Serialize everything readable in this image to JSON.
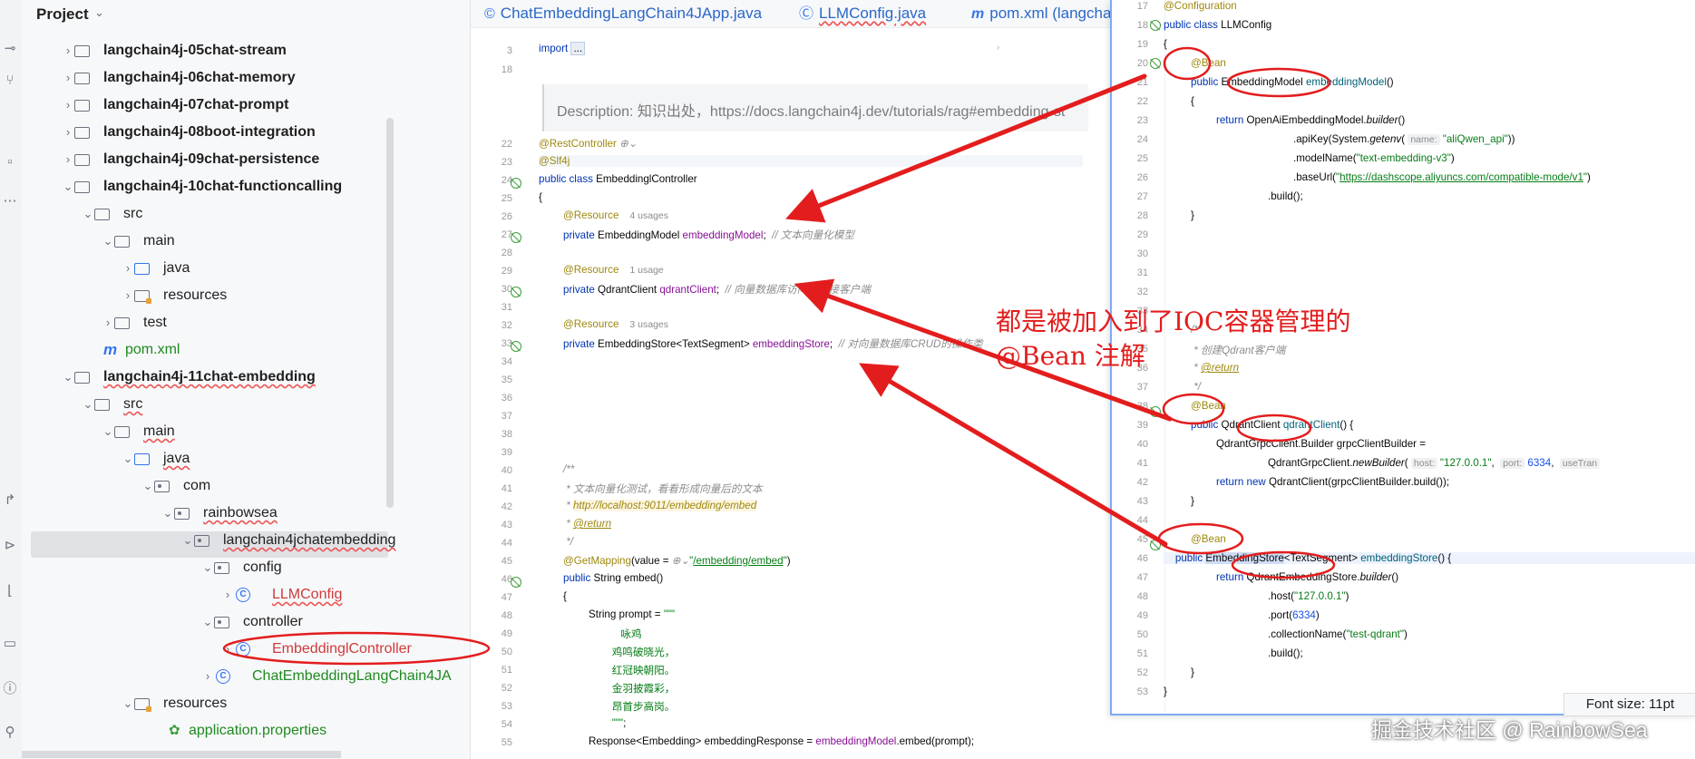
{
  "project_panel": {
    "title": "Project",
    "tree": [
      {
        "label": "langchain4j-05chat-stream",
        "bold": true
      },
      {
        "label": "langchain4j-06chat-memory",
        "bold": true
      },
      {
        "label": "langchain4j-07chat-prompt",
        "bold": true
      },
      {
        "label": "langchain4j-08boot-integration",
        "bold": true
      },
      {
        "label": "langchain4j-09chat-persistence",
        "bold": true
      },
      {
        "label": "langchain4j-10chat-functioncalling",
        "bold": true
      },
      {
        "label": "src"
      },
      {
        "label": "main"
      },
      {
        "label": "java"
      },
      {
        "label": "resources"
      },
      {
        "label": "test"
      },
      {
        "label": "pom.xml"
      },
      {
        "label": "langchain4j-11chat-embedding",
        "bold": true
      },
      {
        "label": "src"
      },
      {
        "label": "main"
      },
      {
        "label": "java"
      },
      {
        "label": "com"
      },
      {
        "label": "rainbowsea"
      },
      {
        "label": "langchain4jchatembedding"
      },
      {
        "label": "config"
      },
      {
        "label": "LLMConfig"
      },
      {
        "label": "controller"
      },
      {
        "label": "EmbeddinglController"
      },
      {
        "label": "ChatEmbeddingLangChain4JA"
      },
      {
        "label": "resources"
      },
      {
        "label": "application.properties"
      }
    ]
  },
  "tabs": [
    {
      "label": "ChatEmbeddingLangChain4JApp.java"
    },
    {
      "label": "LLMConfig.java"
    },
    {
      "label": "pom.xml (langcha"
    }
  ],
  "main_editor": {
    "line_numbers": [
      "3",
      "18",
      "22",
      "23",
      "24",
      "25",
      "26",
      "27",
      "28",
      "29",
      "30",
      "31",
      "32",
      "33",
      "34",
      "35",
      "36",
      "37",
      "38",
      "39",
      "40",
      "41",
      "42",
      "43",
      "44",
      "45",
      "46",
      "47",
      "48",
      "49",
      "50",
      "51",
      "52",
      "53",
      "54",
      "55"
    ],
    "import_line": "import ...",
    "description": "Description: 知识出处，https://docs.langchain4j.dev/tutorials/rag#embedding-st",
    "usages": {
      "embedding_model": "4 usages",
      "qdrant_client": "1 usage",
      "embedding_store": "3 usages"
    }
  },
  "popup_editor": {
    "line_numbers": [
      "17",
      "18",
      "19",
      "20",
      "21",
      "22",
      "23",
      "24",
      "25",
      "26",
      "27",
      "28",
      "29",
      "30",
      "31",
      "32",
      "33",
      "34",
      "35",
      "36",
      "37",
      "38",
      "39",
      "40",
      "41",
      "42",
      "43",
      "44",
      "45",
      "46",
      "47",
      "48",
      "49",
      "50",
      "51",
      "52",
      "53"
    ]
  },
  "annotation": {
    "line1": "都是被加入到了IOC容器管理的",
    "line2": "@Bean 注解",
    "color": "#e31d1d"
  },
  "font_size_tip": "Font size: 11pt",
  "watermark": "掘金技术社区 @ RainbowSea",
  "colors": {
    "keyword": "#0033b3",
    "annotation": "#9e880d",
    "string": "#067d17",
    "comment": "#8c8c8c",
    "field": "#871094",
    "link": "#2b67c8"
  }
}
